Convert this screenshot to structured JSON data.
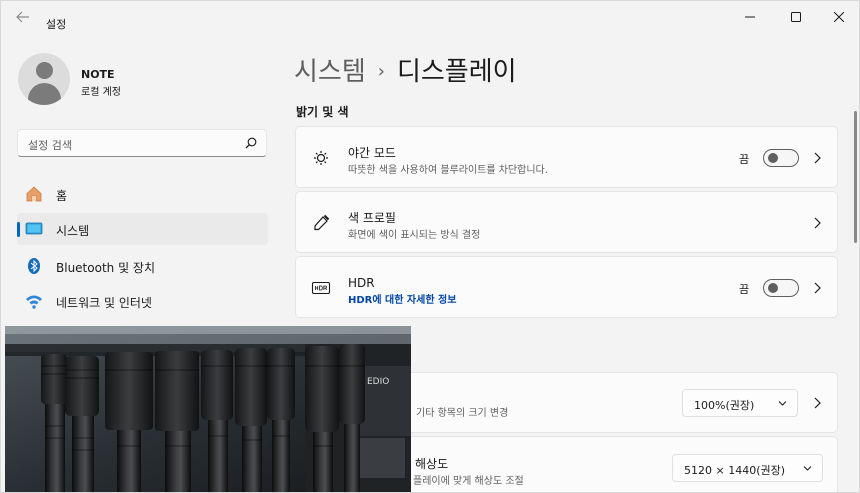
{
  "window": {
    "app_title": "설정"
  },
  "profile": {
    "name": "NOTE",
    "account_type": "로컬 계정"
  },
  "search": {
    "placeholder": "설정 검색"
  },
  "sidebar": {
    "items": [
      {
        "label": "홈",
        "icon": "home-icon"
      },
      {
        "label": "시스템",
        "icon": "system-icon",
        "active": true
      },
      {
        "label": "Bluetooth 및 장치",
        "icon": "bluetooth-icon"
      },
      {
        "label": "네트워크 및 인터넷",
        "icon": "wifi-icon"
      }
    ]
  },
  "breadcrumb": {
    "parent": "시스템",
    "separator": "›",
    "current": "디스플레이"
  },
  "section": {
    "title": "밝기 및 색"
  },
  "cards": {
    "night_mode": {
      "title": "야간 모드",
      "desc": "따뜻한 색을 사용하여 블루라이트를 차단합니다.",
      "state": "끔",
      "enabled": false
    },
    "color_profile": {
      "title": "색 프로필",
      "desc": "화면에 색이 표시되는 방식 결정"
    },
    "hdr": {
      "title": "HDR",
      "link": "HDR에 대한 자세한 정보",
      "state": "끔",
      "enabled": false
    },
    "scale": {
      "desc_visible": "기타 항목의 크기 변경",
      "value": "100%(권장)"
    },
    "resolution": {
      "title_visible": "해상도",
      "desc_visible": "플레이에 맞게 해상도 조절",
      "value": "5120 × 1440(권장)"
    }
  },
  "photo": {
    "overlay_text": "EDIO"
  },
  "colors": {
    "accent": "#0067c0",
    "link": "#0046a8"
  }
}
